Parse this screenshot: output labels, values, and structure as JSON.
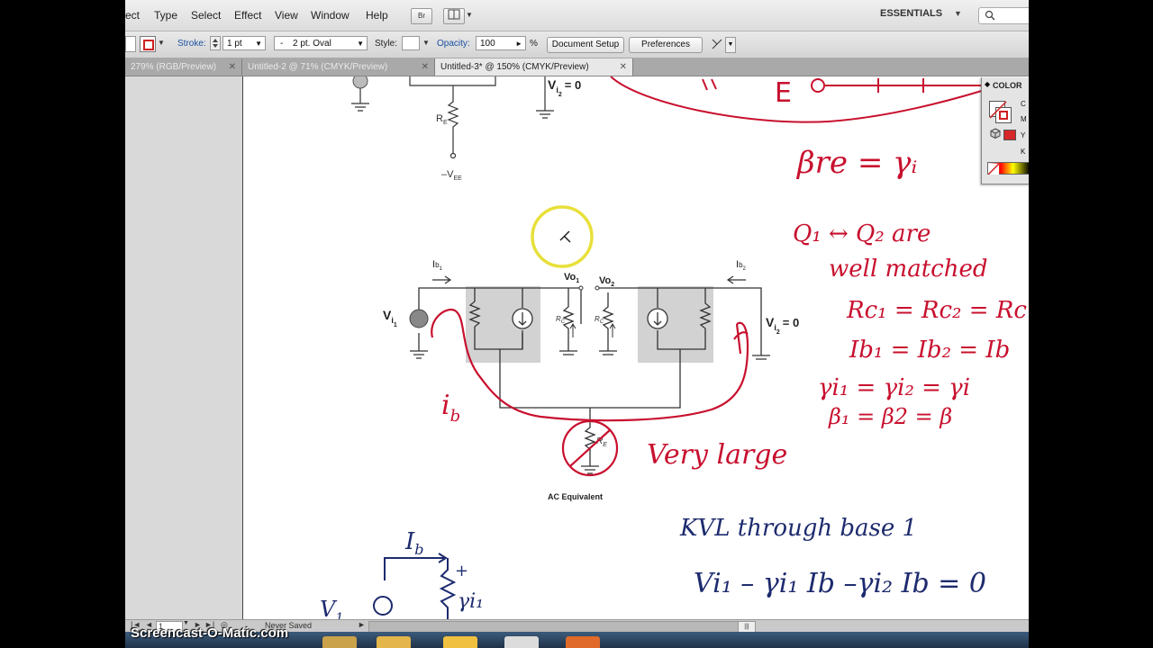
{
  "menu": {
    "items": [
      "ect",
      "Type",
      "Select",
      "Effect",
      "View",
      "Window",
      "Help"
    ],
    "bridge_label": "Br",
    "workspace": "ESSENTIALS"
  },
  "control": {
    "stroke_label": "Stroke:",
    "stroke_value": "1 pt",
    "brush_value": "2 pt. Oval",
    "style_label": "Style:",
    "opacity_label": "Opacity:",
    "opacity_value": "100",
    "percent": "%",
    "doc_setup": "Document Setup",
    "preferences": "Preferences"
  },
  "tabs": [
    {
      "label": "279% (RGB/Preview)"
    },
    {
      "label": "Untitled-2 @ 71% (CMYK/Preview)"
    },
    {
      "label": "Untitled-3* @ 150% (CMYK/Preview)"
    }
  ],
  "panel": {
    "title": "COLOR",
    "letters": [
      "C",
      "M",
      "Y",
      "K"
    ]
  },
  "status": {
    "page": "1",
    "save_state": "Never Saved"
  },
  "watermark": "Screencast-O-Matic.com",
  "diagram": {
    "vi1": "V",
    "vi1_sub": "i",
    "vi1_sub2": "1",
    "vi2_zero": "V",
    "vi2_sub": "i",
    "vi2_sub2": "2",
    "eq_zero": "= 0",
    "ib1": "I",
    "ib1_sub": "b",
    "ib1_sub2": "1",
    "ib2": "I",
    "ib2_sub": "b",
    "ib2_sub2": "2",
    "vo1": "Vo",
    "vo1_sub": "1",
    "vo2": "Vo",
    "vo2_sub": "2",
    "re": "R",
    "re_sub": "E",
    "rc": "R",
    "rc_sub": "C",
    "vee": "–V",
    "vee_sub": "EE",
    "vi2_top": "V",
    "vi2_top_sub": "i",
    "vi2_top_sub2": "2",
    "vi2_top_eq": "= 0",
    "caption": "AC Equivalent"
  },
  "notes": {
    "red": {
      "top_E": "E",
      "beta_re": "βre = γᵢ",
      "q_matched_1": "Q₁ ↔ Q₂ are",
      "q_matched_2": "well matched",
      "rc_eq": "Rc₁ = Rc₂ = Rc",
      "ib_eq": "Ib₁ = Ib₂ = Ib",
      "ri_eq": "γi₁ = γi₂ = γi",
      "beta_eq": "β₁ = β2 = β",
      "very_large": "Very large",
      "ib_label": "i",
      "ib_label_sub": "b"
    },
    "blue": {
      "kvl": "KVL  through  base  1",
      "equation": "Vi₁ – γi₁ Ib –γi₂ Ib = 0",
      "ib_small": "I",
      "ib_small_sub": "b",
      "plus": "+",
      "ri_small": "γi₁",
      "v_small": "V",
      "v_small_sub": "1"
    }
  }
}
